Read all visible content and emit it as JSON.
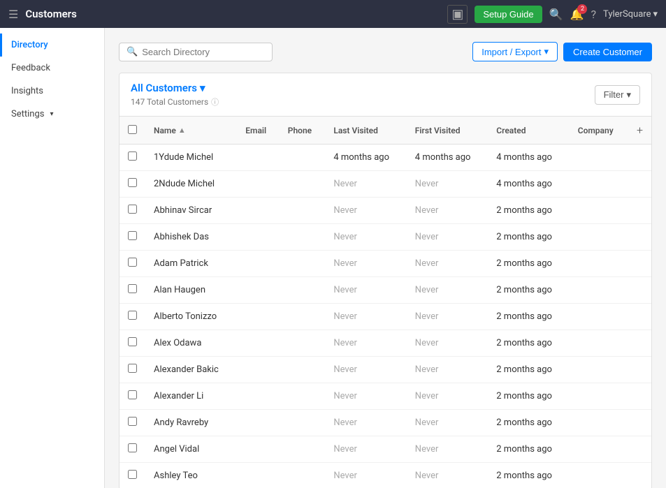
{
  "app": {
    "title": "Customers",
    "menu_icon": "☰",
    "box_icon": "▣"
  },
  "topnav": {
    "setup_guide": "Setup Guide",
    "bell_badge": "2",
    "user_label": "TylerSquare",
    "user_chevron": "▾"
  },
  "sidebar": {
    "items": [
      {
        "label": "Directory",
        "active": true
      },
      {
        "label": "Feedback",
        "active": false
      },
      {
        "label": "Insights",
        "active": false
      },
      {
        "label": "Settings",
        "active": false
      }
    ]
  },
  "search": {
    "placeholder": "Search Directory"
  },
  "toolbar": {
    "import_export_label": "Import / Export",
    "import_export_chevron": "▾",
    "create_label": "Create Customer"
  },
  "customers": {
    "section_title": "All Customers",
    "section_chevron": "▾",
    "total_label": "147 Total Customers",
    "filter_label": "Filter",
    "filter_chevron": "▾"
  },
  "table": {
    "columns": [
      {
        "key": "name",
        "label": "Name",
        "sortable": true
      },
      {
        "key": "email",
        "label": "Email"
      },
      {
        "key": "phone",
        "label": "Phone"
      },
      {
        "key": "last_visited",
        "label": "Last Visited"
      },
      {
        "key": "first_visited",
        "label": "First Visited"
      },
      {
        "key": "created",
        "label": "Created"
      },
      {
        "key": "company",
        "label": "Company"
      }
    ],
    "rows": [
      {
        "name": "1Ydude Michel",
        "email": "",
        "phone": "",
        "last_visited": "4 months ago",
        "first_visited": "4 months ago",
        "created": "4 months ago",
        "company": ""
      },
      {
        "name": "2Ndude Michel",
        "email": "",
        "phone": "",
        "last_visited": "Never",
        "first_visited": "Never",
        "created": "4 months ago",
        "company": ""
      },
      {
        "name": "Abhinav Sircar",
        "email": "",
        "phone": "",
        "last_visited": "Never",
        "first_visited": "Never",
        "created": "2 months ago",
        "company": ""
      },
      {
        "name": "Abhishek Das",
        "email": "",
        "phone": "",
        "last_visited": "Never",
        "first_visited": "Never",
        "created": "2 months ago",
        "company": ""
      },
      {
        "name": "Adam Patrick",
        "email": "",
        "phone": "",
        "last_visited": "Never",
        "first_visited": "Never",
        "created": "2 months ago",
        "company": ""
      },
      {
        "name": "Alan Haugen",
        "email": "",
        "phone": "",
        "last_visited": "Never",
        "first_visited": "Never",
        "created": "2 months ago",
        "company": ""
      },
      {
        "name": "Alberto Tonizzo",
        "email": "",
        "phone": "",
        "last_visited": "Never",
        "first_visited": "Never",
        "created": "2 months ago",
        "company": ""
      },
      {
        "name": "Alex Odawa",
        "email": "",
        "phone": "",
        "last_visited": "Never",
        "first_visited": "Never",
        "created": "2 months ago",
        "company": ""
      },
      {
        "name": "Alexander Bakic",
        "email": "",
        "phone": "",
        "last_visited": "Never",
        "first_visited": "Never",
        "created": "2 months ago",
        "company": ""
      },
      {
        "name": "Alexander Li",
        "email": "",
        "phone": "",
        "last_visited": "Never",
        "first_visited": "Never",
        "created": "2 months ago",
        "company": ""
      },
      {
        "name": "Andy Ravreby",
        "email": "",
        "phone": "",
        "last_visited": "Never",
        "first_visited": "Never",
        "created": "2 months ago",
        "company": ""
      },
      {
        "name": "Angel Vidal",
        "email": "",
        "phone": "",
        "last_visited": "Never",
        "first_visited": "Never",
        "created": "2 months ago",
        "company": ""
      },
      {
        "name": "Ashley Teo",
        "email": "",
        "phone": "",
        "last_visited": "Never",
        "first_visited": "Never",
        "created": "2 months ago",
        "company": ""
      }
    ]
  }
}
